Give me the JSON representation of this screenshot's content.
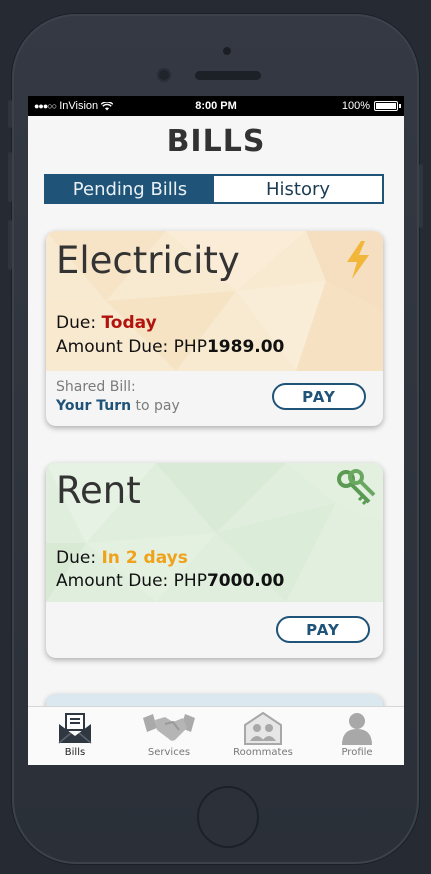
{
  "statusbar": {
    "carrier": "InVision",
    "time": "8:00 PM",
    "battery": "100%"
  },
  "page": {
    "title": "BILLS"
  },
  "segments": {
    "pending": "Pending Bills",
    "history": "History",
    "active": "pending"
  },
  "bills": [
    {
      "name": "Electricity",
      "due_label": "Due: ",
      "due_value": "Today",
      "due_color": "#b3130e",
      "amount_label": "Amount Due: PHP",
      "amount_value": "1989.00",
      "shared_label": "Shared Bill:",
      "turn_label": "Your Turn",
      "turn_suffix": " to pay",
      "pay_label": "PAY",
      "icon": "lightning-icon"
    },
    {
      "name": "Rent",
      "due_label": "Due: ",
      "due_value": "In 2 days",
      "due_color": "#f0a21b",
      "amount_label": "Amount Due: PHP",
      "amount_value": "7000.00",
      "pay_label": "PAY",
      "icon": "keys-icon"
    }
  ],
  "tabbar": {
    "items": [
      {
        "label": "Bills",
        "icon": "bill-envelope-icon",
        "active": true
      },
      {
        "label": "Services",
        "icon": "handshake-icon",
        "active": false
      },
      {
        "label": "Roommates",
        "icon": "roommates-icon",
        "active": false
      },
      {
        "label": "Profile",
        "icon": "person-icon",
        "active": false
      }
    ]
  },
  "colors": {
    "accent": "#1f5377",
    "overdue": "#b3130e",
    "upcoming": "#f0a21b"
  }
}
